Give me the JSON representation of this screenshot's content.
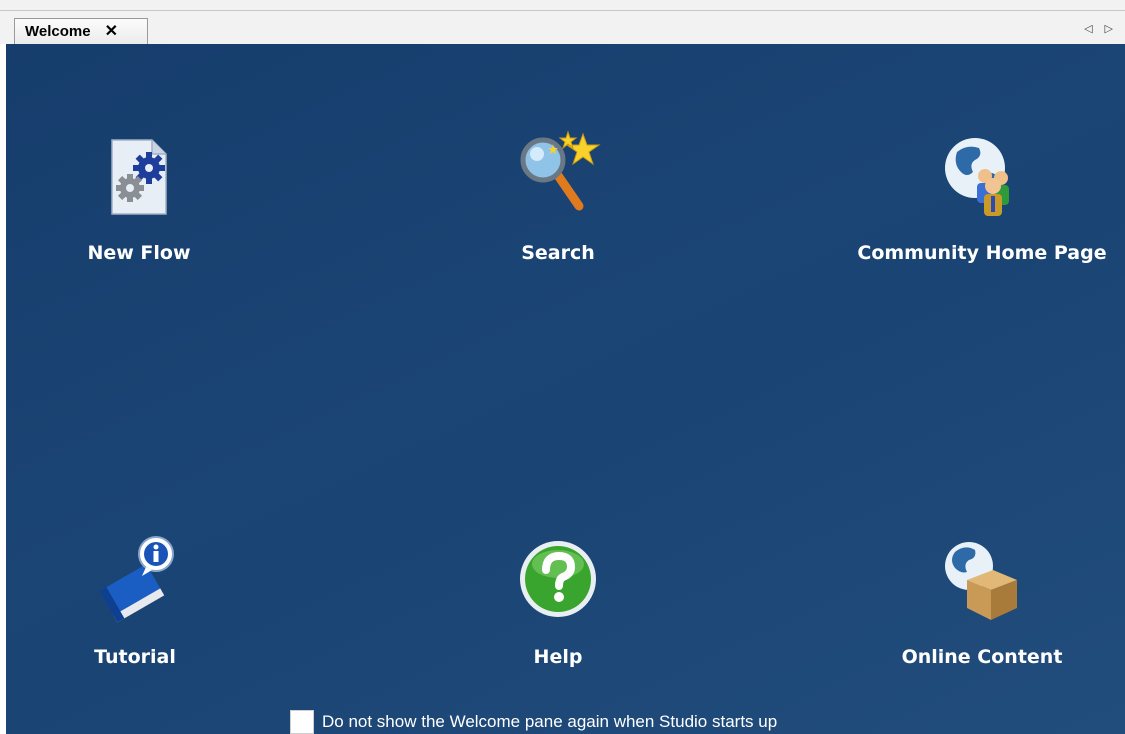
{
  "tab": {
    "title": "Welcome",
    "close_glyph": "✕"
  },
  "scroll": {
    "left_glyph": "◁",
    "right_glyph": "▷"
  },
  "items": [
    {
      "label": "New Flow",
      "icon": "new-flow-icon"
    },
    {
      "label": "Search",
      "icon": "search-icon"
    },
    {
      "label": "Community Home Page",
      "icon": "community-globe-icon"
    },
    {
      "label": "Tutorial",
      "icon": "tutorial-book-icon"
    },
    {
      "label": "Help",
      "icon": "help-icon"
    },
    {
      "label": "Online Content",
      "icon": "online-content-icon"
    }
  ],
  "footer": {
    "checkbox_label": "Do not show the Welcome pane again when Studio starts up",
    "checked": false
  },
  "colors": {
    "pane_bg": "#1b4575",
    "label": "#ffffff",
    "tabbar_bg": "#f2f2f2"
  }
}
